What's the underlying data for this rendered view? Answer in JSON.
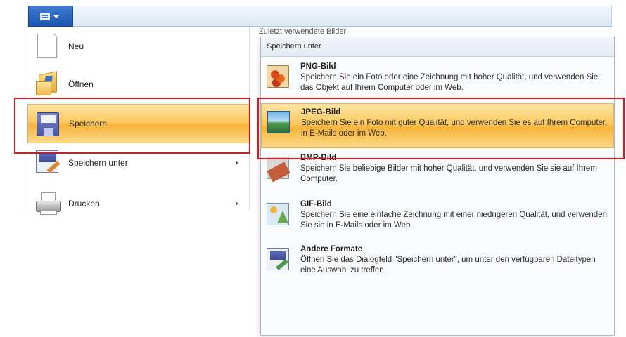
{
  "menu": {
    "items": [
      {
        "label": "Neu",
        "icon": "new-document-icon"
      },
      {
        "label": "Öffnen",
        "icon": "open-folder-icon"
      },
      {
        "label": "Speichern",
        "icon": "save-floppy-icon"
      },
      {
        "label": "Speichern unter",
        "icon": "save-as-icon"
      },
      {
        "label": "Drucken",
        "icon": "printer-icon"
      }
    ]
  },
  "recent": {
    "header": "Zuletzt verwendete Bilder"
  },
  "flyout": {
    "title": "Speichern unter",
    "items": [
      {
        "title": "PNG-Bild",
        "description": "Speichern Sie ein Foto oder eine Zeichnung mit hoher Qualität, und verwenden Sie das Objekt auf Ihrem Computer oder im Web."
      },
      {
        "title": "JPEG-Bild",
        "description": "Speichern Sie ein Foto mit guter Qualität, und verwenden Sie es auf Ihrem Computer, in E-Mails oder im Web."
      },
      {
        "title": "BMP-Bild",
        "description": "Speichern Sie beliebige Bilder mit hoher Qualität, und verwenden Sie sie auf Ihrem Computer."
      },
      {
        "title": "GIF-Bild",
        "description": "Speichern Sie eine einfache Zeichnung mit einer niedrigeren Qualität, und verwenden Sie sie in E-Mails oder im Web."
      },
      {
        "title": "Andere Formate",
        "description": "Öffnen Sie das Dialogfeld \"Speichern unter\", um unter den verfügbaren Dateitypen eine Auswahl zu treffen."
      }
    ]
  },
  "colors": {
    "highlight": "#e3121b",
    "hover_gradient_top": "#fde6a4",
    "hover_gradient_mid": "#f7b43a",
    "app_button": "#1d56ad"
  }
}
